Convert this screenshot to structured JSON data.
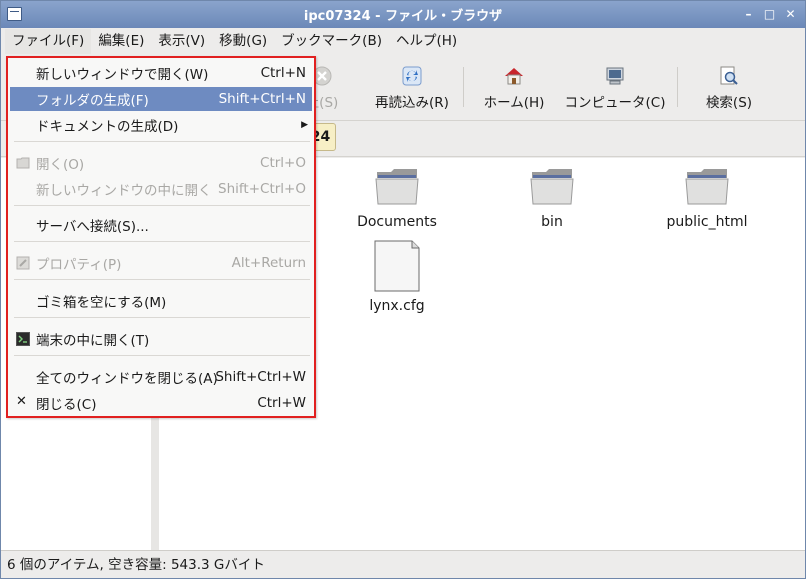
{
  "window": {
    "title": "ipc07324 - ファイル・ブラウザ"
  },
  "menubar": [
    {
      "label": "ファイル(F)"
    },
    {
      "label": "編集(E)"
    },
    {
      "label": "表示(V)"
    },
    {
      "label": "移動(G)"
    },
    {
      "label": "ブックマーク(B)"
    },
    {
      "label": "ヘルプ(H)"
    }
  ],
  "toolbar": {
    "stop_partial": "止(S)",
    "reload": "再読込み(R)",
    "home": "ホーム(H)",
    "computer": "コンピュータ(C)",
    "search": "検索(S)"
  },
  "location": {
    "button_label": "24"
  },
  "files": [
    {
      "name": "Documents",
      "type": "folder"
    },
    {
      "name": "bin",
      "type": "folder"
    },
    {
      "name": "public_html",
      "type": "folder"
    },
    {
      "name": "lynx.cfg",
      "type": "file"
    }
  ],
  "status": {
    "text": "6 個のアイテム, 空き容量: 543.3 Gバイト"
  },
  "file_menu": {
    "items": [
      {
        "label": "新しいウィンドウで開く(W)",
        "accel": "Ctrl+N"
      },
      {
        "label": "フォルダの生成(F)",
        "accel": "Shift+Ctrl+N"
      },
      {
        "label": "ドキュメントの生成(D)",
        "accel": ""
      },
      {
        "label": "開く(O)",
        "accel": "Ctrl+O"
      },
      {
        "label": "新しいウィンドウの中に開く",
        "accel": "Shift+Ctrl+O"
      },
      {
        "label": "サーバへ接続(S)...",
        "accel": ""
      },
      {
        "label": "プロパティ(P)",
        "accel": "Alt+Return"
      },
      {
        "label": "ゴミ箱を空にする(M)",
        "accel": ""
      },
      {
        "label": "端末の中に開く(T)",
        "accel": ""
      },
      {
        "label": "全てのウィンドウを閉じる(A)",
        "accel": "Shift+Ctrl+W"
      },
      {
        "label": "閉じる(C)",
        "accel": "Ctrl+W"
      }
    ]
  },
  "colors": {
    "highlight": "#6e8bc1",
    "titlebar": "#7a96c2",
    "callout": "#e12020"
  }
}
